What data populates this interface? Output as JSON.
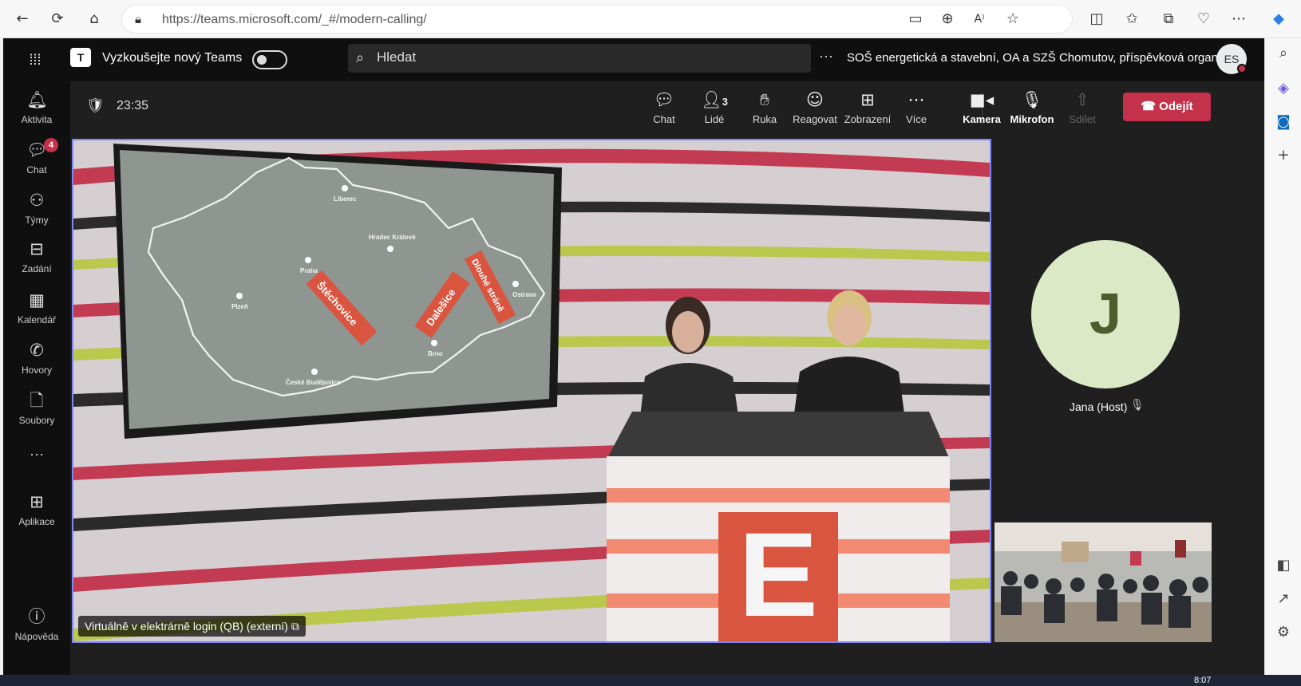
{
  "browser": {
    "url": "https://teams.microsoft.com/_#/modern-calling/",
    "icons": [
      "back-icon",
      "refresh-icon",
      "home-icon",
      "lock-icon",
      "camera-icon",
      "zoom-icon",
      "read-aloud-icon",
      "favorite-icon",
      "split-screen-icon",
      "favorites-icon",
      "collections-icon",
      "performance-icon",
      "more-icon",
      "copilot-icon"
    ]
  },
  "edge_sidebar": {
    "icons": [
      "search-icon",
      "copilot-icon",
      "outlook-icon",
      "add-icon",
      "sidebar-icon",
      "open-external-icon",
      "settings-icon"
    ]
  },
  "teams": {
    "topbar": {
      "try_new_label": "Vyzkoušejte nový Teams",
      "search_placeholder": "Hledat",
      "more": "···",
      "org_name": "SOŠ energetická a stavební, OA a SZŠ Chomutov, příspěvková organizace",
      "avatar_initials": "ES"
    },
    "rail": [
      {
        "label": "Aktivita",
        "icon": "bell-icon"
      },
      {
        "label": "Chat",
        "icon": "chat-icon",
        "badge": "4"
      },
      {
        "label": "Týmy",
        "icon": "teams-icon"
      },
      {
        "label": "Zadání",
        "icon": "assignments-icon"
      },
      {
        "label": "Kalendář",
        "icon": "calendar-icon"
      },
      {
        "label": "Hovory",
        "icon": "phone-icon"
      },
      {
        "label": "Soubory",
        "icon": "file-icon"
      },
      {
        "label": "···",
        "icon": "more-icon"
      },
      {
        "label": "Aplikace",
        "icon": "apps-icon"
      },
      {
        "label": "Nápověda",
        "icon": "help-icon"
      }
    ],
    "meeting": {
      "timer": "23:35",
      "controls": {
        "chat": "Chat",
        "people": "Lidé",
        "people_count": "3",
        "hand": "Ruka",
        "react": "Reagovat",
        "view": "Zobrazení",
        "more": "Více",
        "camera": "Kamera",
        "mic": "Mikrofon",
        "share": "Sdílet"
      },
      "leave": "Odejít"
    },
    "stage": {
      "caption": "Virtuálně v elektrárně login (QB) (externí)",
      "map_cities": [
        "Liberec",
        "Hradec Králové",
        "Praha",
        "Plzeň",
        "Ostrava",
        "Brno",
        "České Budějovice"
      ],
      "map_tags": [
        "Štěchovice",
        "Dalešice",
        "Dlouhé stráně"
      ],
      "logo_letter": "E"
    },
    "participant": {
      "initial": "J",
      "name": "Jana (Host)"
    }
  },
  "taskbar": {
    "time": "8:07"
  }
}
